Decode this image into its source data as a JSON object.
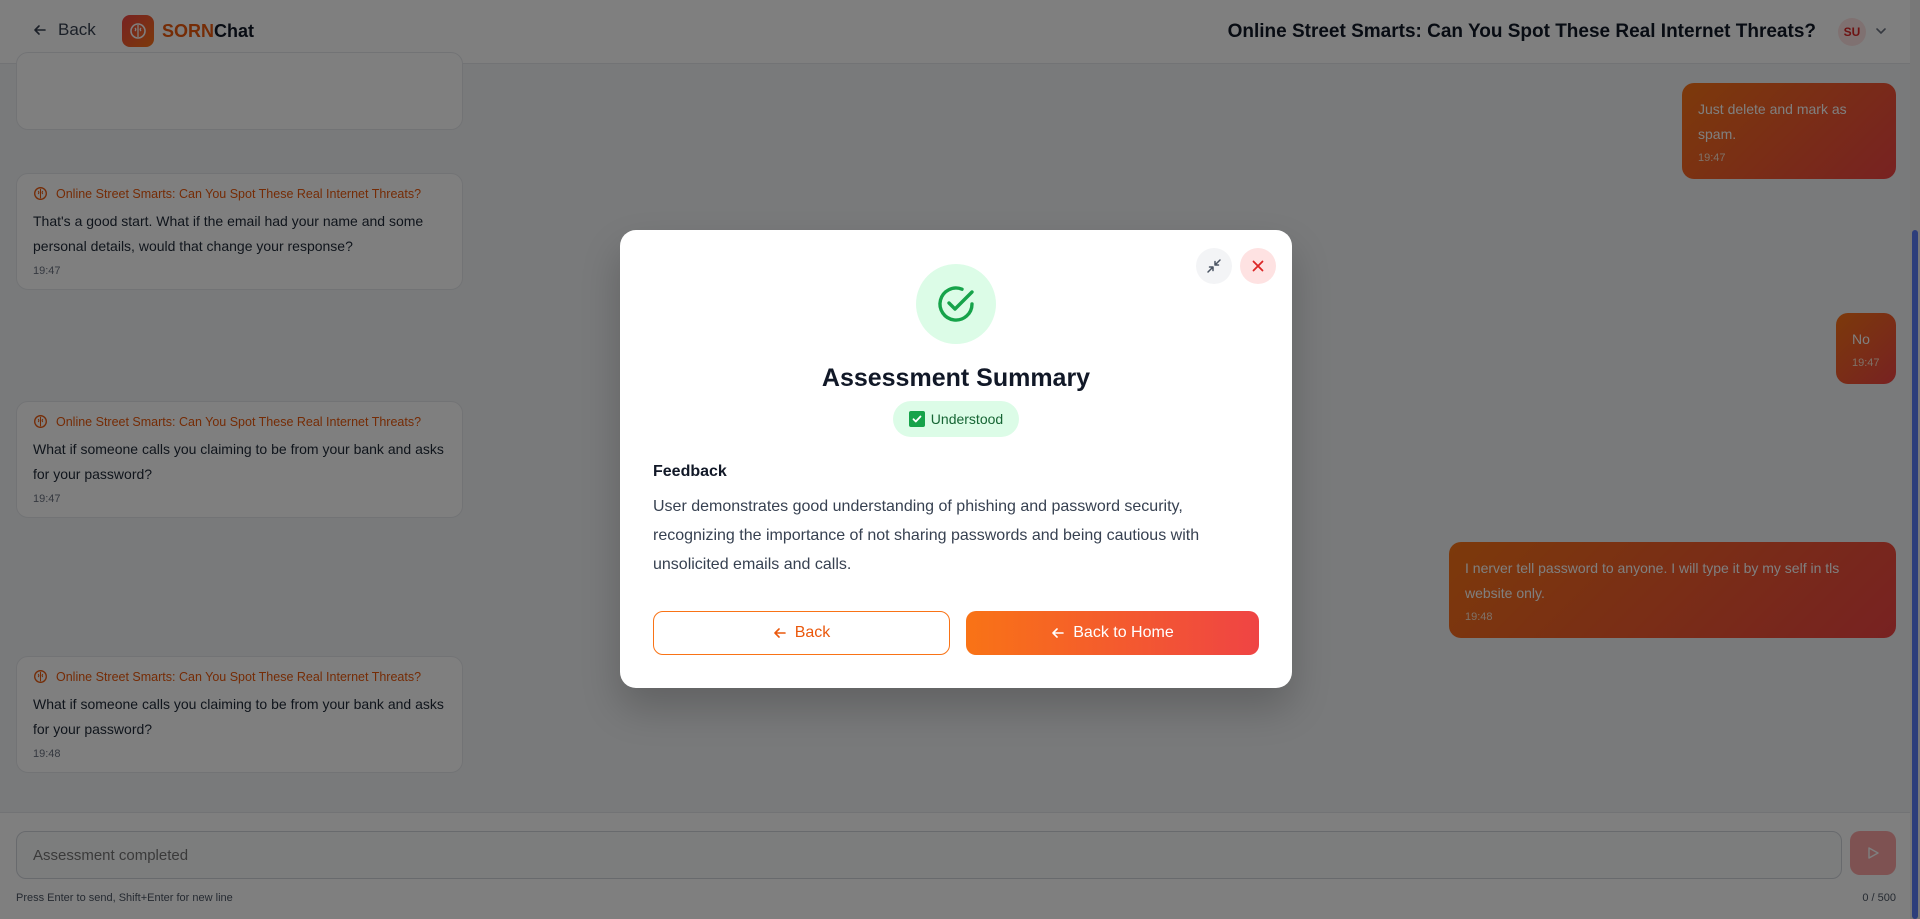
{
  "header": {
    "back_label": "Back",
    "brand_part1": "SORN",
    "brand_part2": "Chat",
    "title": "Online Street Smarts: Can You Spot These Real Internet Threats?",
    "avatar_initials": "SU"
  },
  "messages": [
    {
      "role": "user",
      "text": "Just delete and mark as spam.",
      "time": "19:47"
    },
    {
      "role": "bot",
      "sender": "Online Street Smarts: Can You Spot These Real Internet Threats?",
      "text": "That's a good start. What if the email had your name and some personal details, would that change your response?",
      "time": "19:47"
    },
    {
      "role": "user",
      "text": "No",
      "time": "19:47"
    },
    {
      "role": "bot",
      "sender": "Online Street Smarts: Can You Spot These Real Internet Threats?",
      "text": "What if someone calls you claiming to be from your bank and asks for your password?",
      "time": "19:47"
    },
    {
      "role": "user",
      "text": "I nerver tell password to anyone. I will type it by my self in tls website only.",
      "time": "19:48"
    },
    {
      "role": "bot",
      "sender": "Online Street Smarts: Can You Spot These Real Internet Threats?",
      "text": "What if someone calls you claiming to be from your bank and asks for your password?",
      "time": "19:48"
    }
  ],
  "input": {
    "placeholder": "Assessment completed",
    "hint": "Press Enter to send, Shift+Enter for new line",
    "counter": "0 / 500"
  },
  "modal": {
    "title": "Assessment Summary",
    "status": "Understood",
    "feedback_label": "Feedback",
    "feedback_text": "User demonstrates good understanding of phishing and password security, recognizing the importance of not sharing passwords and being cautious with unsolicited emails and calls.",
    "back_label": "Back",
    "home_label": "Back to Home"
  },
  "colors": {
    "accent": "#f97316",
    "accent2": "#ef4444",
    "success": "#16a34a",
    "scrollbar": "#5b7cf6"
  }
}
